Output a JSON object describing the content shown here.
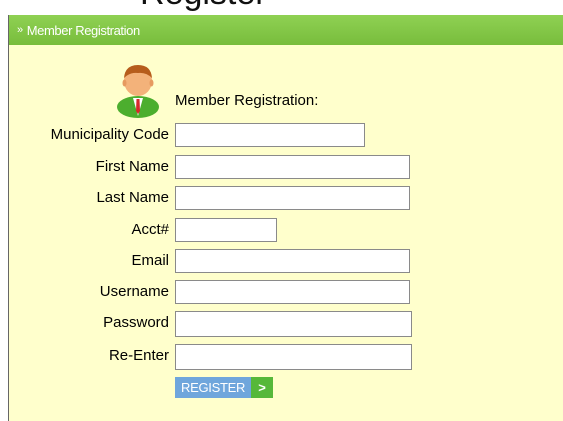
{
  "page": {
    "heading": "Register"
  },
  "panel": {
    "header_title": "Member Registration",
    "header_icon": "double-chevron-icon"
  },
  "form": {
    "title": "Member Registration:",
    "fields": [
      {
        "label": "Municipality Code",
        "value": "",
        "type": "text"
      },
      {
        "label": "First Name",
        "value": "",
        "type": "text"
      },
      {
        "label": "Last Name",
        "value": "",
        "type": "text"
      },
      {
        "label": "Acct#",
        "value": "",
        "type": "text"
      },
      {
        "label": "Email",
        "value": "",
        "type": "text"
      },
      {
        "label": "Username",
        "value": "",
        "type": "text"
      },
      {
        "label": "Password",
        "value": "",
        "type": "password"
      },
      {
        "label": "Re-Enter",
        "value": "",
        "type": "password"
      }
    ],
    "submit": {
      "label": "REGISTER",
      "arrow": ">"
    }
  },
  "colors": {
    "header_green": "#78bd3c",
    "panel_bg": "#ffffcc",
    "button_blue": "#6fa6dc",
    "button_green": "#56b83a"
  }
}
